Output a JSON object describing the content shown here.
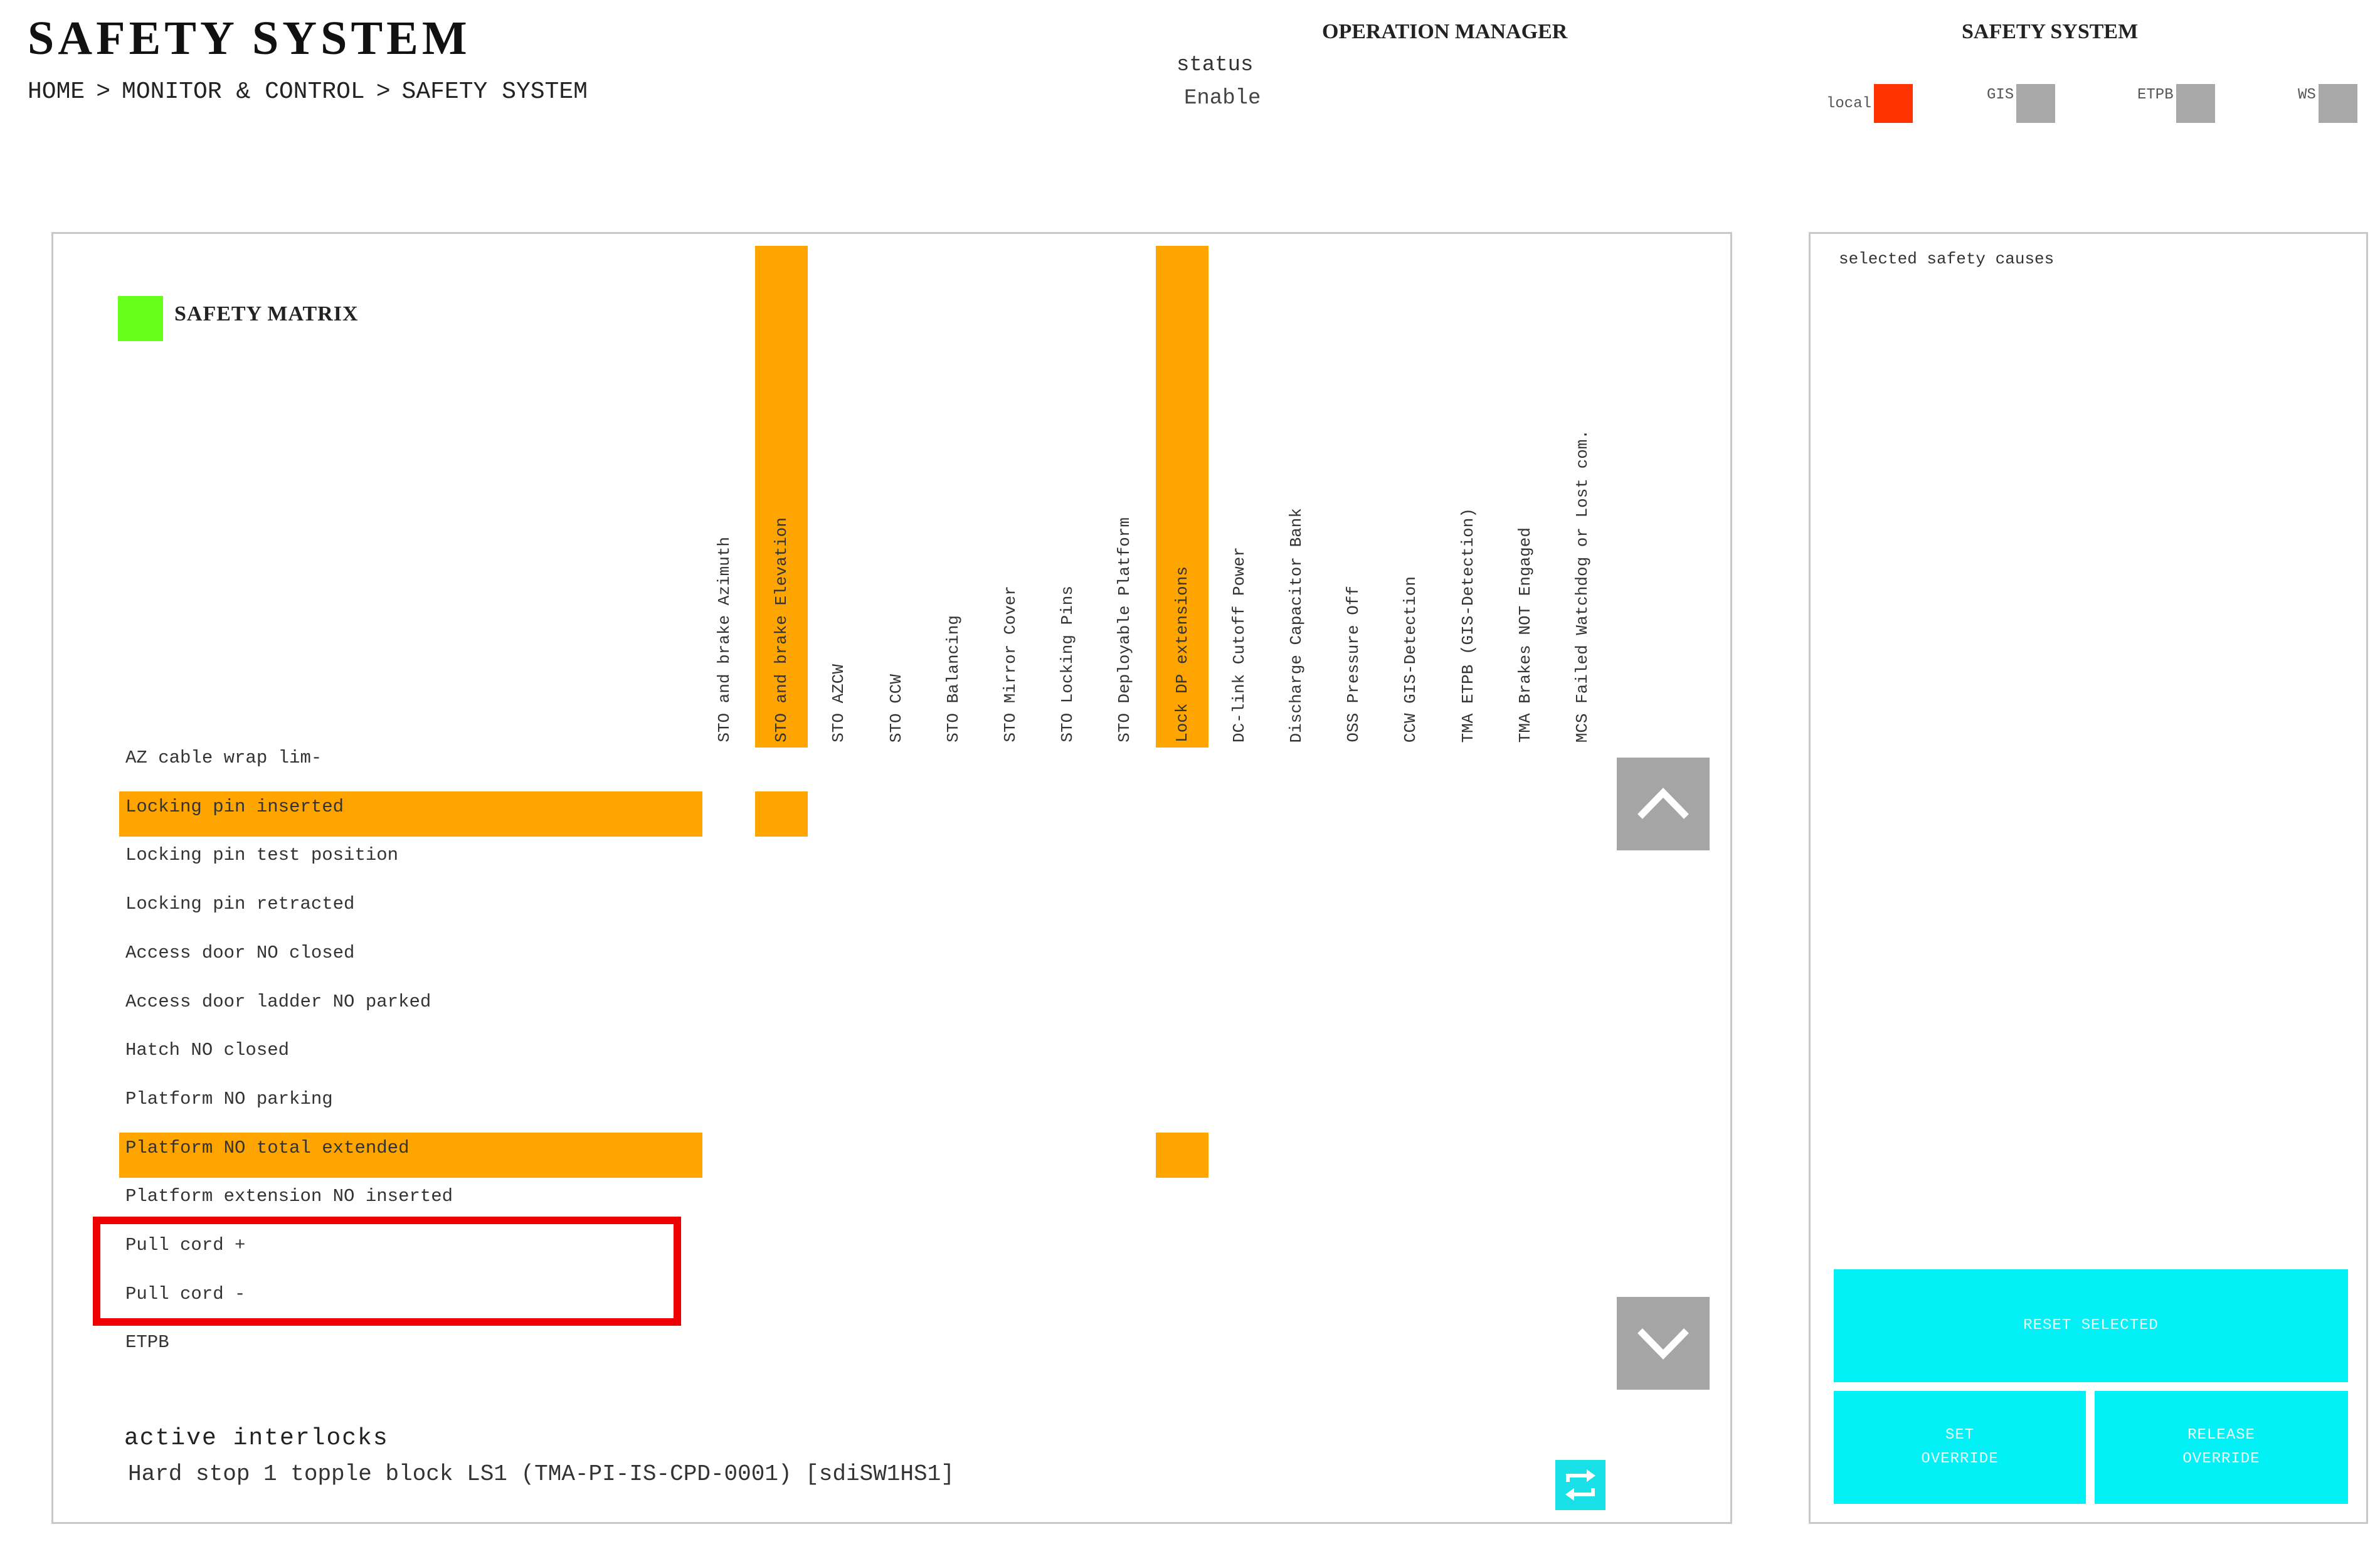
{
  "header": {
    "title": "SAFETY SYSTEM",
    "breadcrumb": [
      "HOME",
      ">",
      "MONITOR & CONTROL",
      ">",
      "SAFETY SYSTEM"
    ],
    "operation_manager": {
      "title": "OPERATION MANAGER",
      "status_label": "status",
      "status_value": "Enable"
    },
    "safety_system": {
      "title": "SAFETY SYSTEM",
      "indicators": [
        {
          "label": "local",
          "color": "#ff3300"
        },
        {
          "label": "GIS",
          "color": "#a8a8a8"
        },
        {
          "label": "ETPB",
          "color": "#a8a8a8"
        },
        {
          "label": "WS",
          "color": "#a8a8a8"
        }
      ]
    }
  },
  "matrix": {
    "title": "SAFETY MATRIX",
    "status_color": "#66ff1a",
    "highlight_color": "#ffa500",
    "columns": [
      {
        "label": "STO and brake Azimuth",
        "highlighted": false
      },
      {
        "label": "STO and brake Elevation",
        "highlighted": true
      },
      {
        "label": "STO AZCW",
        "highlighted": false
      },
      {
        "label": "STO CCW",
        "highlighted": false
      },
      {
        "label": "STO Balancing",
        "highlighted": false
      },
      {
        "label": "STO Mirror Cover",
        "highlighted": false
      },
      {
        "label": "STO Locking Pins",
        "highlighted": false
      },
      {
        "label": "STO Deployable Platform",
        "highlighted": false
      },
      {
        "label": "Lock DP extensions",
        "highlighted": true
      },
      {
        "label": "DC-link Cutoff Power",
        "highlighted": false
      },
      {
        "label": "Discharge Capacitor Bank",
        "highlighted": false
      },
      {
        "label": "OSS Pressure Off",
        "highlighted": false
      },
      {
        "label": "CCW GIS-Detection",
        "highlighted": false
      },
      {
        "label": "TMA ETPB (GIS-Detection)",
        "highlighted": false
      },
      {
        "label": "TMA Brakes NOT Engaged",
        "highlighted": false
      },
      {
        "label": "MCS Failed Watchdog or Lost com.",
        "highlighted": false
      }
    ],
    "rows": [
      {
        "label": "AZ cable wrap lim-",
        "highlighted": false
      },
      {
        "label": "Locking pin inserted",
        "highlighted": true
      },
      {
        "label": "Locking pin test position",
        "highlighted": false
      },
      {
        "label": "Locking pin retracted",
        "highlighted": false
      },
      {
        "label": "Access door NO closed",
        "highlighted": false
      },
      {
        "label": "Access door ladder NO parked",
        "highlighted": false
      },
      {
        "label": "Hatch NO closed",
        "highlighted": false
      },
      {
        "label": "Platform NO parking",
        "highlighted": false
      },
      {
        "label": "Platform NO total extended",
        "highlighted": true
      },
      {
        "label": "Platform extension NO inserted",
        "highlighted": false
      },
      {
        "label": "Pull cord +",
        "highlighted": false
      },
      {
        "label": "Pull cord -",
        "highlighted": false
      },
      {
        "label": "ETPB",
        "highlighted": false
      }
    ],
    "active_cells": [
      {
        "row": 1,
        "col": 1
      },
      {
        "row": 8,
        "col": 8
      }
    ],
    "scroll_up_icon": "chevron-up-icon",
    "scroll_down_icon": "chevron-down-icon",
    "active_interlocks_label": "active interlocks",
    "active_interlocks_value": "Hard stop 1 topple block LS1 (TMA-PI-IS-CPD-0001) [sdiSW1HS1]",
    "refresh_icon": "refresh-icon"
  },
  "side_panel": {
    "title": "selected safety causes",
    "button_color": "#00f2f7",
    "reset_label": "RESET SELECTED",
    "set_override_label": "SET\nOVERRIDE",
    "release_override_label": "RELEASE\nOVERRIDE"
  }
}
